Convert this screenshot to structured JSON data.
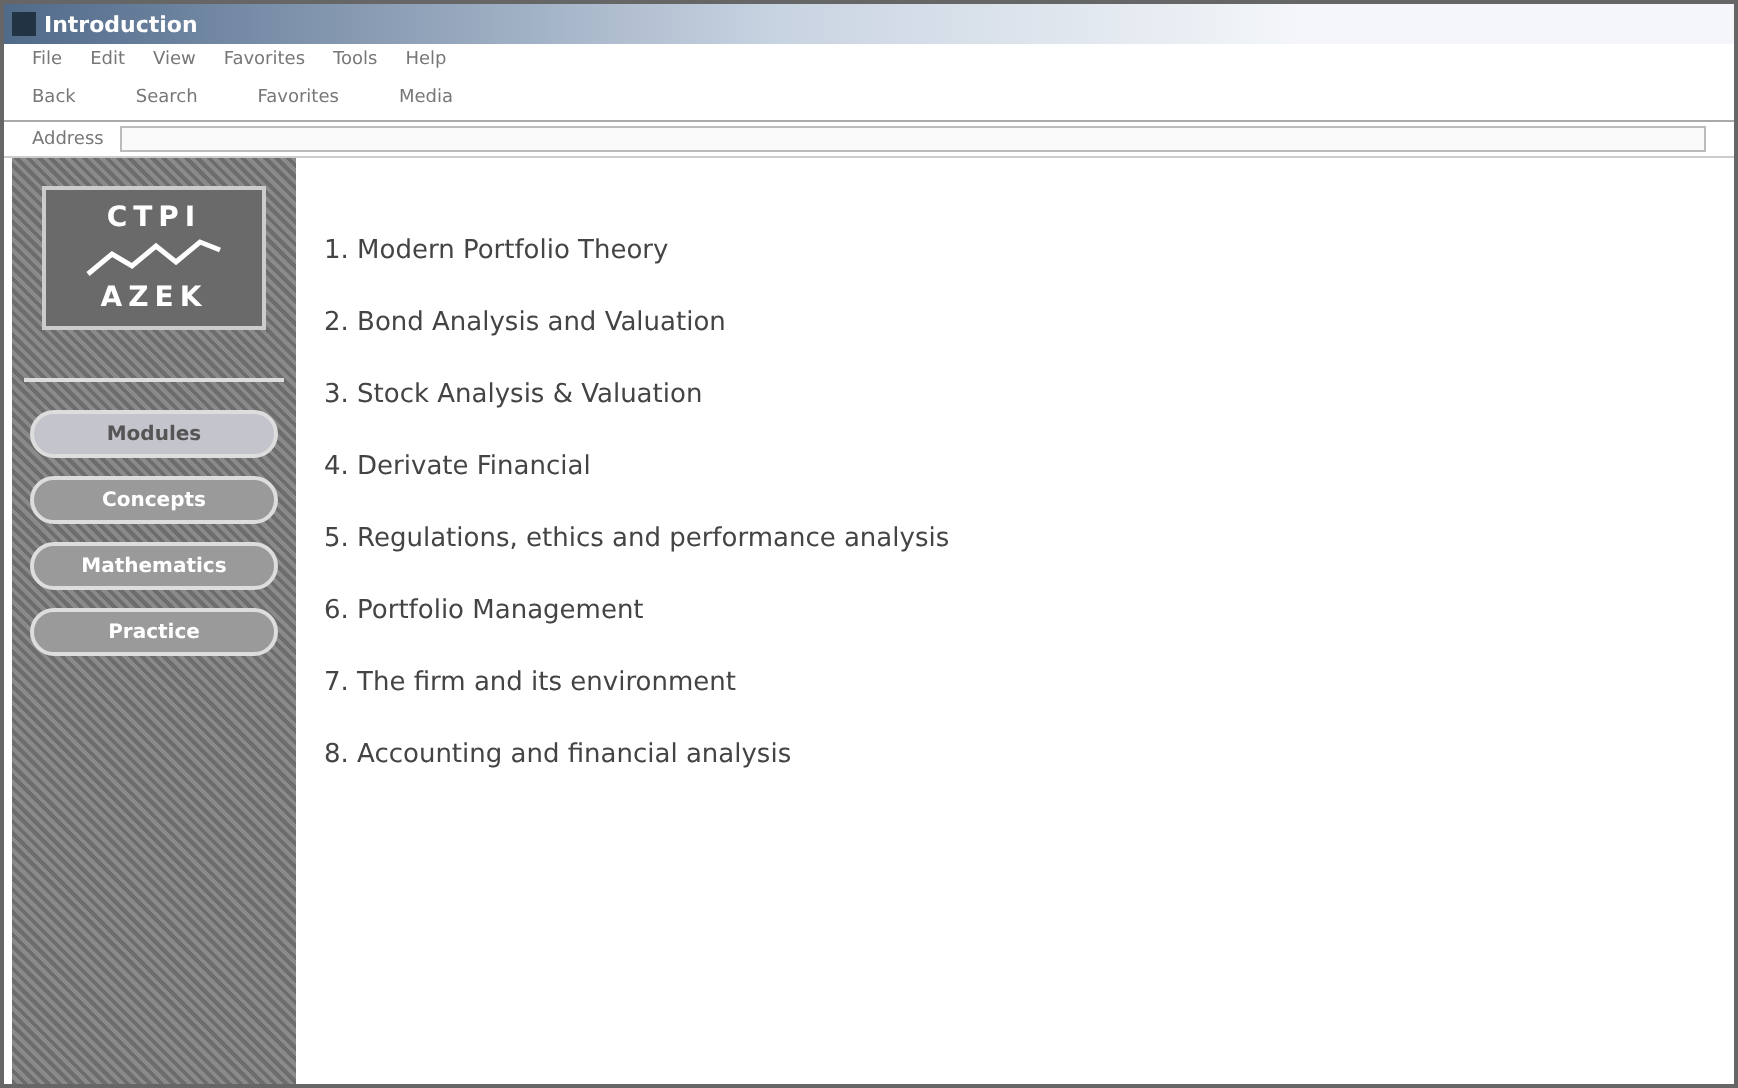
{
  "window": {
    "title": "Introduction"
  },
  "menu": [
    "File",
    "Edit",
    "View",
    "Favorites",
    "Tools",
    "Help"
  ],
  "toolbar": [
    "Back",
    "Search",
    "Favorites",
    "Media"
  ],
  "address": {
    "label": "Address"
  },
  "logo": {
    "top": "CTPI",
    "bottom": "AZEK"
  },
  "sidebar": {
    "items": [
      {
        "label": "Modules",
        "selected": true
      },
      {
        "label": "Concepts",
        "selected": false
      },
      {
        "label": "Mathematics",
        "selected": false
      },
      {
        "label": "Practice",
        "selected": false
      }
    ]
  },
  "topics": [
    "1. Modern Portfolio Theory",
    "2. Bond Analysis and Valuation",
    "3. Stock Analysis & Valuation",
    "4. Derivate Financial",
    "5. Regulations, ethics and performance analysis",
    "6. Portfolio Management",
    "7. The firm and its environment",
    "8. Accounting and financial analysis"
  ]
}
